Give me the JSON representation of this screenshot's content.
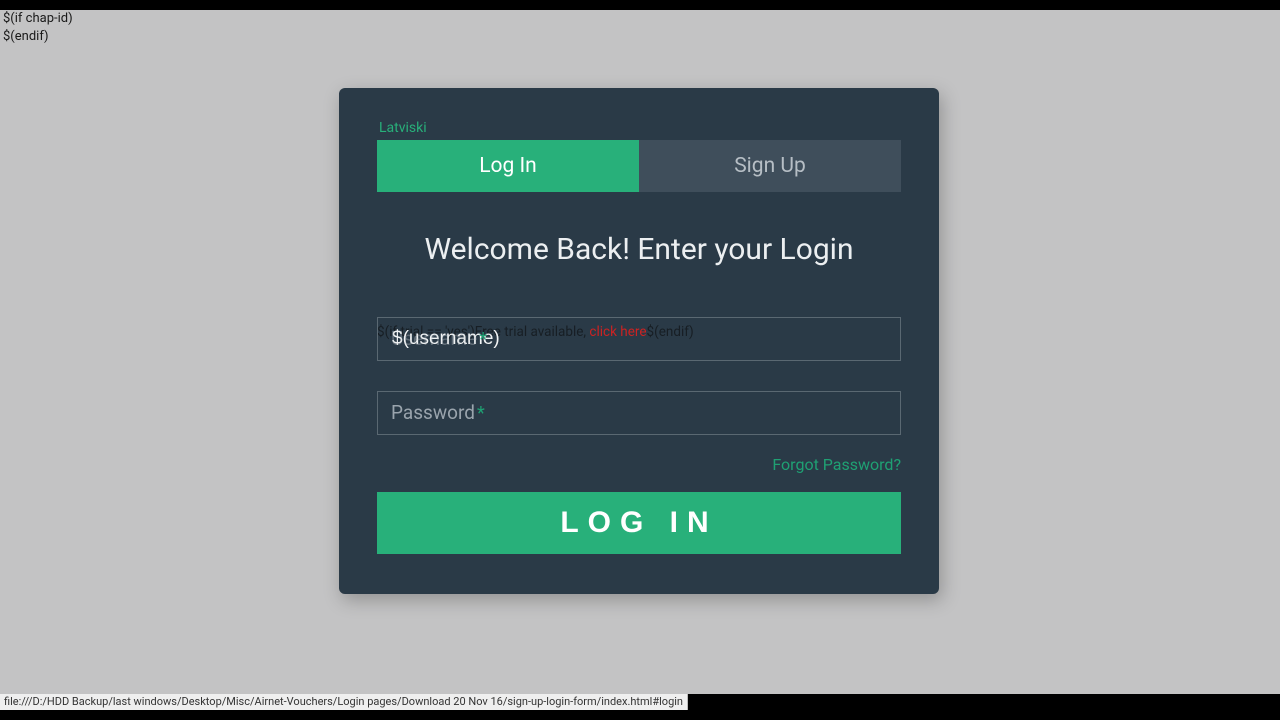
{
  "template": {
    "line1": "$(if chap-id)",
    "line2": "$(endif)"
  },
  "card": {
    "lang": "Latviski",
    "tabs": {
      "login": "Log In",
      "signup": "Sign Up"
    },
    "welcome": "Welcome Back! Enter your Login",
    "trial": {
      "pre": "$(if trial == 'yes')Free trial available, ",
      "link": "click here",
      "post": "$(endif)"
    },
    "username": {
      "label": "Username",
      "value": "$(username)"
    },
    "password": {
      "label": "Password"
    },
    "forgot": "Forgot Password?",
    "button": "LOG IN"
  },
  "status": "file:///D:/HDD Backup/last windows/Desktop/Misc/Airnet-Vouchers/Login pages/Download 20 Nov 16/sign-up-login-form/index.html#login"
}
